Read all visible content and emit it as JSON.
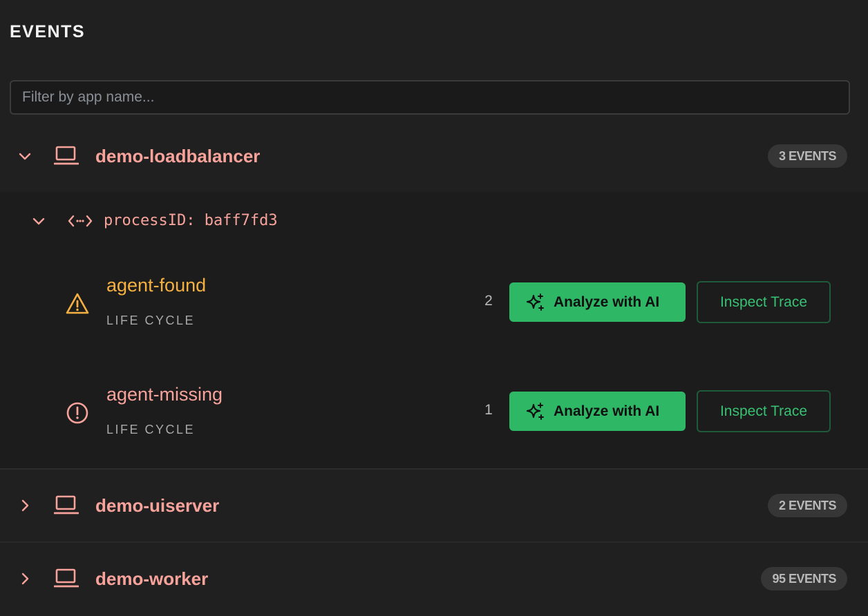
{
  "header": {
    "title": "EVENTS"
  },
  "filter": {
    "placeholder": "Filter by app name..."
  },
  "colors": {
    "app_name": "#f7a39b",
    "warning": "#f5b042",
    "error": "#f7a39b",
    "accent_green": "#2eb866"
  },
  "apps": [
    {
      "name": "demo-loadbalancer",
      "badge": "3 EVENTS",
      "expanded": true,
      "icon": "laptop-icon",
      "process": {
        "label": "processID: baff7fd3",
        "icon": "code-icon",
        "expanded": true,
        "events": [
          {
            "name": "agent-found",
            "category": "LIFE CYCLE",
            "count": "2",
            "status_icon": "warning-triangle-icon",
            "analyze_label": "Analyze with AI",
            "inspect_label": "Inspect Trace"
          },
          {
            "name": "agent-missing",
            "category": "LIFE CYCLE",
            "count": "1",
            "status_icon": "alert-circle-icon",
            "analyze_label": "Analyze with AI",
            "inspect_label": "Inspect Trace"
          }
        ]
      }
    },
    {
      "name": "demo-uiserver",
      "badge": "2 EVENTS",
      "expanded": false,
      "icon": "laptop-icon"
    },
    {
      "name": "demo-worker",
      "badge": "95 EVENTS",
      "expanded": false,
      "icon": "laptop-icon"
    }
  ]
}
